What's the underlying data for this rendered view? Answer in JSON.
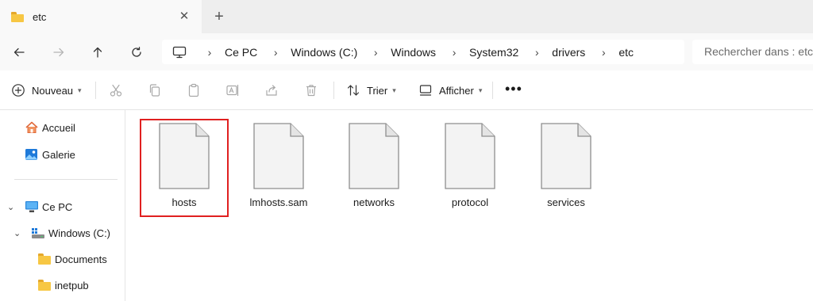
{
  "tab": {
    "title": "etc",
    "close": "✕",
    "new_tab": "+"
  },
  "nav": {
    "back": "back-arrow-icon",
    "forward": "forward-arrow-icon",
    "up": "up-arrow-icon",
    "refresh": "refresh-icon",
    "breadcrumb": [
      "Ce PC",
      "Windows (C:)",
      "Windows",
      "System32",
      "drivers",
      "etc"
    ],
    "search_placeholder": "Rechercher dans : etc"
  },
  "commands": {
    "new_label": "Nouveau",
    "sort_label": "Trier",
    "view_label": "Afficher",
    "more": "•••"
  },
  "sidebar": {
    "home": "Accueil",
    "gallery": "Galerie",
    "this_pc": "Ce PC",
    "drive": "Windows (C:)",
    "documents": "Documents",
    "inetpub": "inetpub"
  },
  "files": [
    {
      "name": "hosts",
      "selected": true
    },
    {
      "name": "lmhosts.sam",
      "selected": false
    },
    {
      "name": "networks",
      "selected": false
    },
    {
      "name": "protocol",
      "selected": false
    },
    {
      "name": "services",
      "selected": false
    }
  ],
  "colors": {
    "selection_outline": "#e02020",
    "folder": "#f7c744",
    "accent": "#0067c0"
  }
}
